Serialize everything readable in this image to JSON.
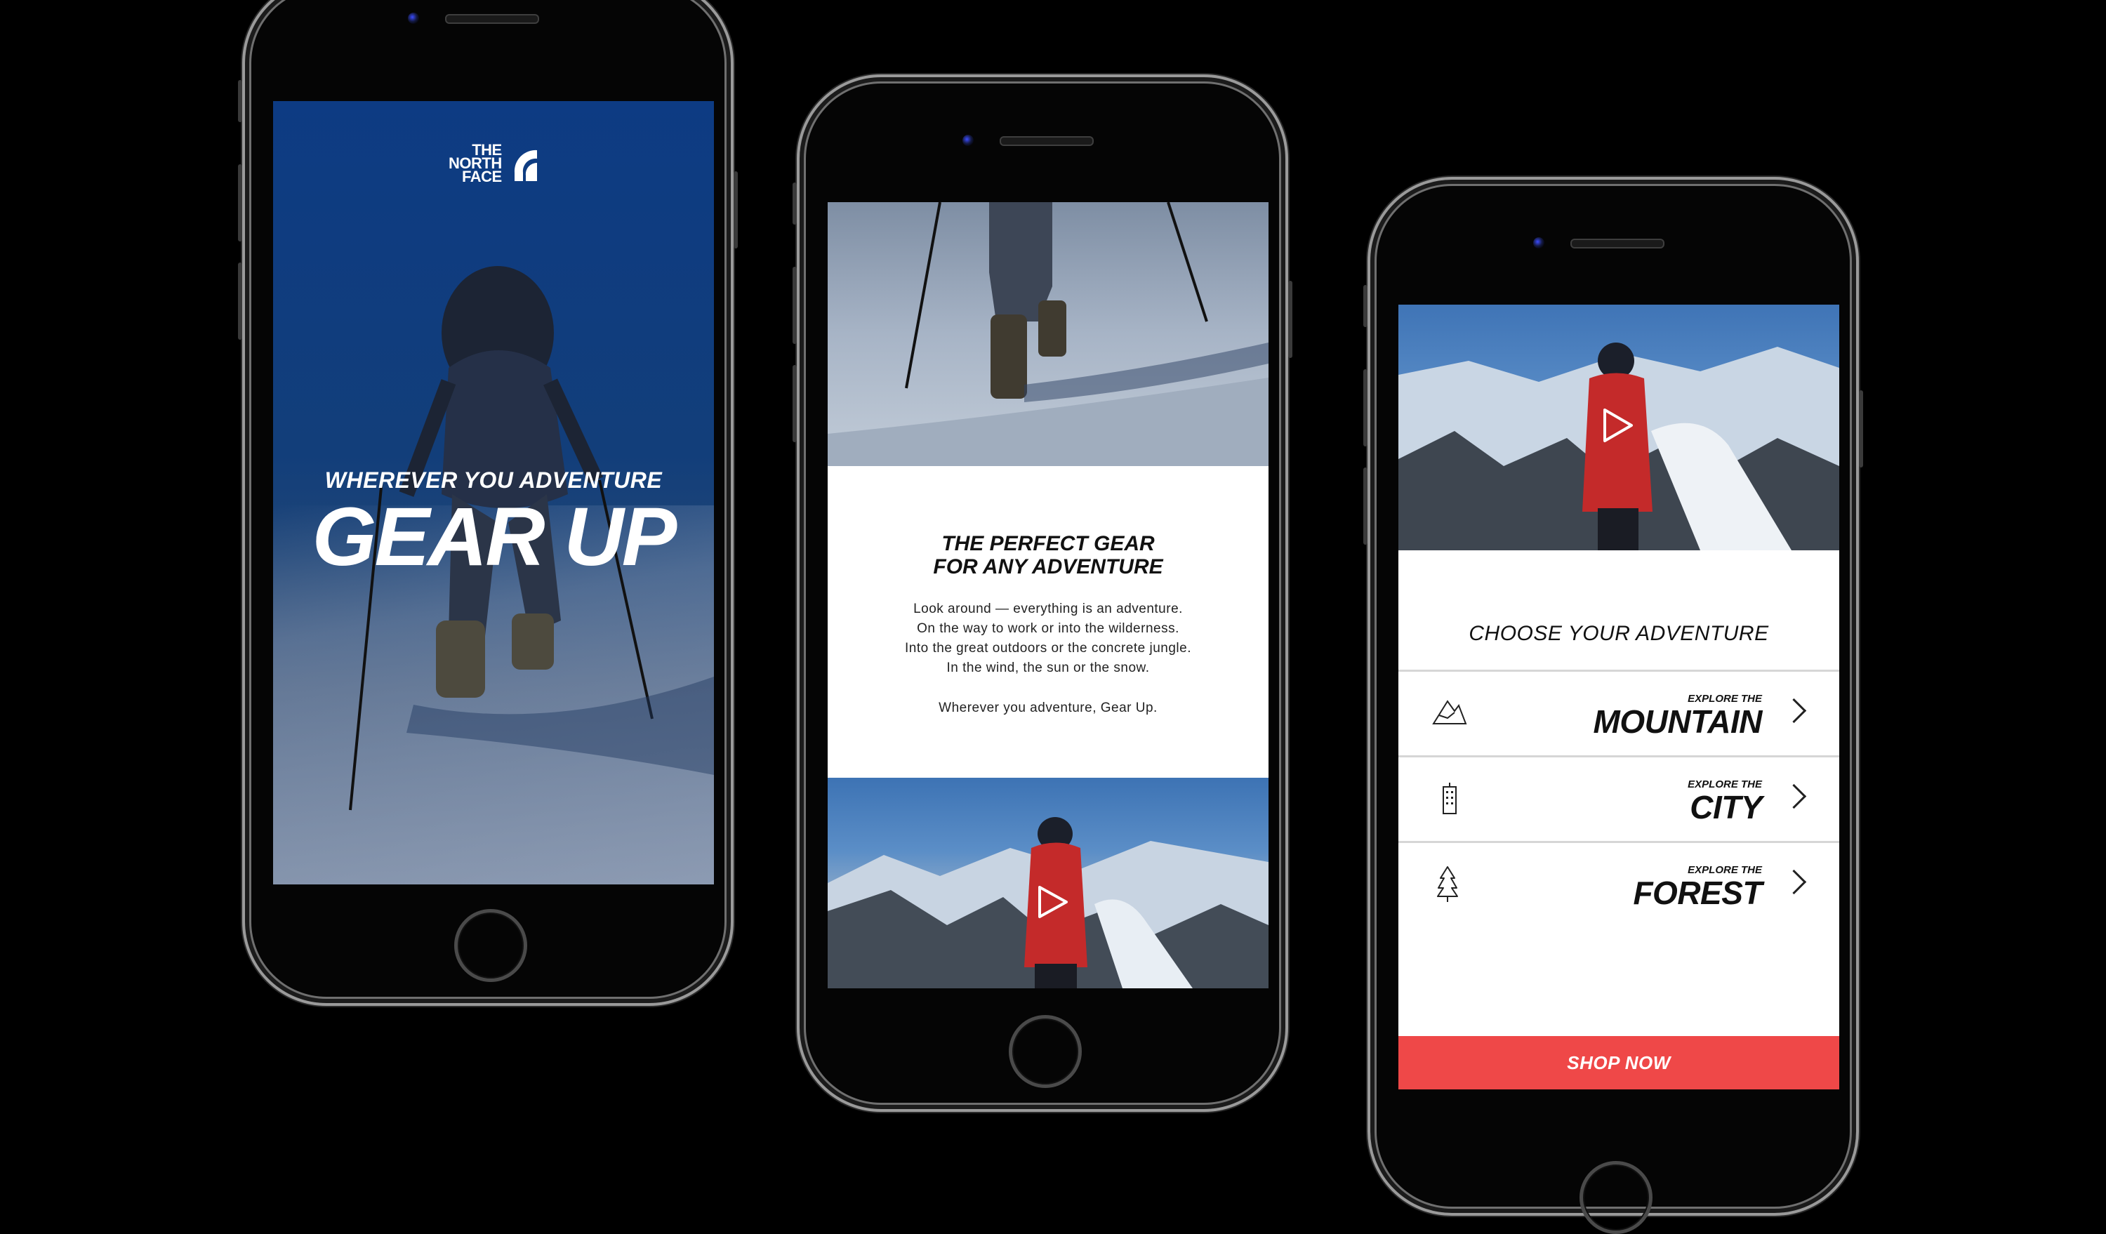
{
  "phone1": {
    "logo": [
      "THE",
      "NORTH",
      "FACE"
    ],
    "hero_subtitle": "WHEREVER YOU ADVENTURE",
    "hero_title": "GEAR UP"
  },
  "phone2": {
    "title_line1": "THE PERFECT GEAR",
    "title_line2": "FOR ANY ADVENTURE",
    "body": [
      "Look around —  everything is an adventure.",
      "On the way to work or into the wilderness.",
      "Into the great outdoors or the concrete jungle.",
      "In the wind, the sun or the snow."
    ],
    "sign_off": "Wherever you adventure, Gear Up."
  },
  "phone3": {
    "heading": "CHOOSE YOUR ADVENTURE",
    "options": [
      {
        "pre": "EXPLORE THE",
        "label": "MOUNTAIN",
        "icon": "mountain-icon"
      },
      {
        "pre": "EXPLORE THE",
        "label": "CITY",
        "icon": "building-icon"
      },
      {
        "pre": "EXPLORE THE",
        "label": "FOREST",
        "icon": "tree-icon"
      }
    ],
    "cta": "SHOP NOW",
    "cta_color": "#ef4848"
  }
}
